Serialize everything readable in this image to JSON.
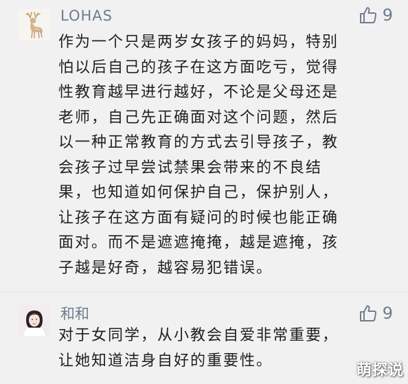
{
  "comments": [
    {
      "username": "LOHAS",
      "likes": "9",
      "avatar_icon": "deer-icon",
      "lines": [
        "作为一个只是两岁女孩子的妈妈，特别",
        "怕以后自己的孩子在这方面吃亏，觉得",
        "性教育越早进行越好，不论是父母还是",
        "老师，自己先正确面对这个问题，然后",
        "以一种正常教育的方式去引导孩子，教",
        "会孩子过早尝试禁果会带来的不良结",
        "果，也知道如何保护自己，保护别人，",
        "让孩子在这方面有疑问的时候也能正确",
        "面对。而不是遮遮掩掩，越是遮掩，孩",
        "子越是好奇，越容易犯错误。"
      ]
    },
    {
      "username": "和和",
      "likes": "9",
      "avatar_icon": "user-photo-icon",
      "lines": [
        "对于女同学，从小教会自爱非常重要，",
        "让她知道洁身自好的重要性。"
      ]
    }
  ],
  "watermark": "萌探说",
  "colors": {
    "background": "#f1f1f1",
    "username": "#6f7c8f",
    "text": "#1f1f1f",
    "like": "#6f7c8f"
  }
}
